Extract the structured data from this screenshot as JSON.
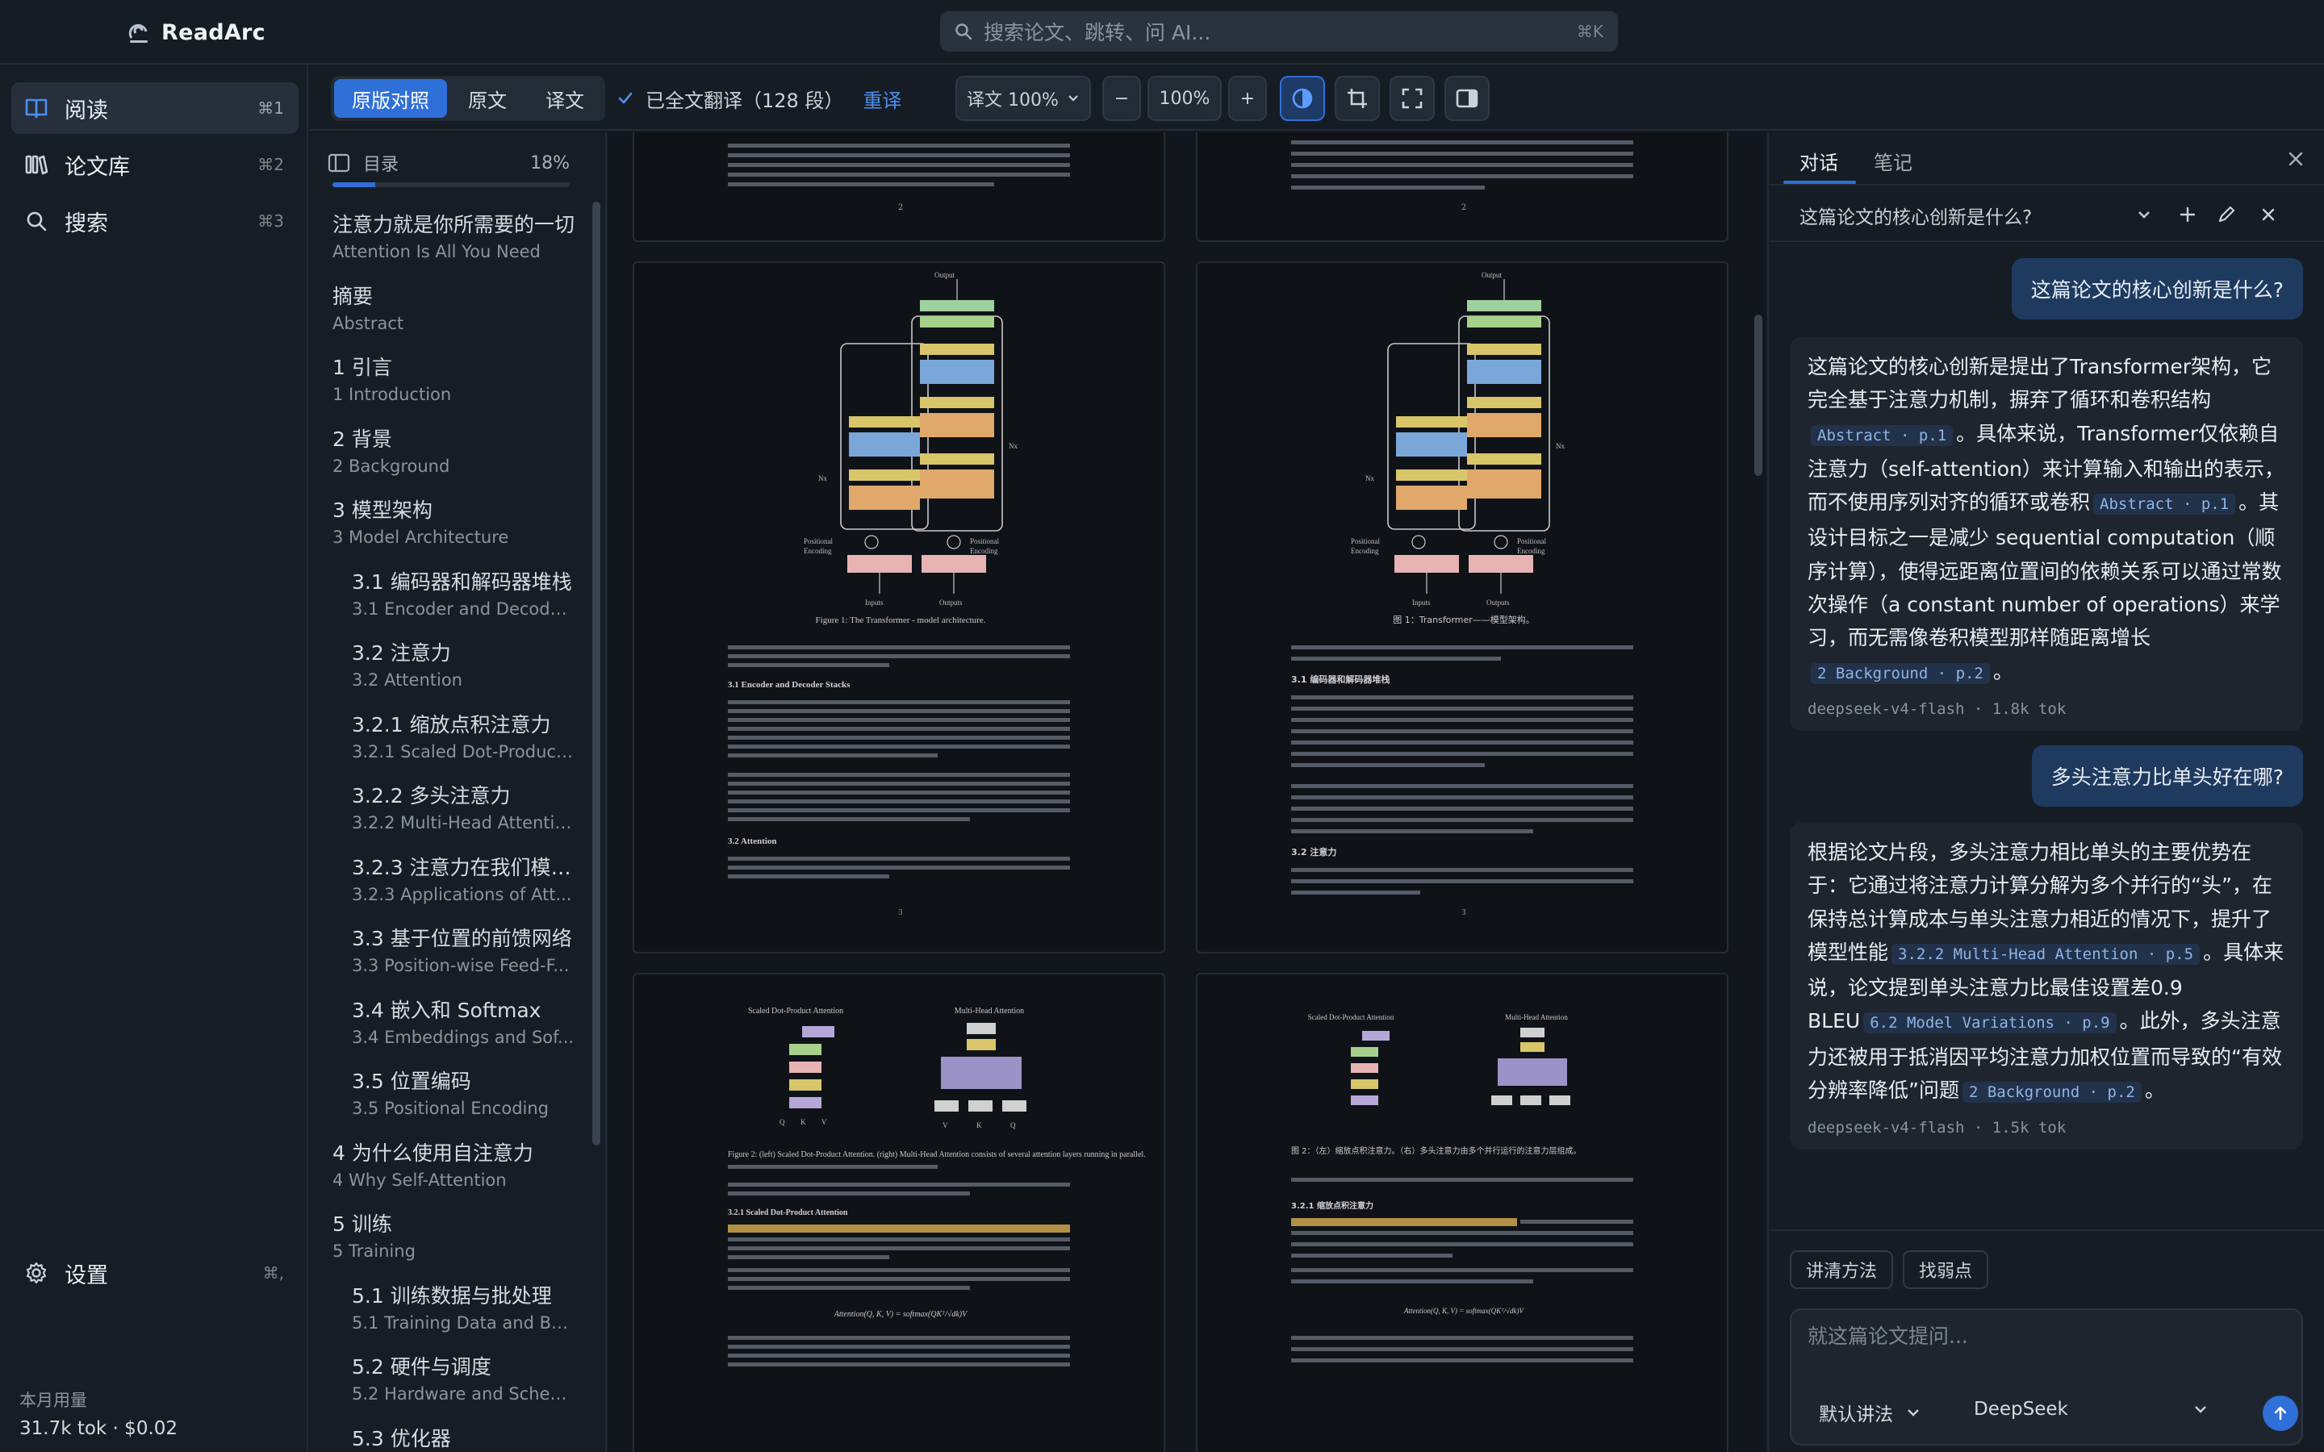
{
  "app": {
    "name": "ReadArc"
  },
  "search": {
    "placeholder": "搜索论文、跳转、问 AI...",
    "shortcut": "⌘K"
  },
  "nav": {
    "items": [
      {
        "label": "阅读",
        "shortcut": "⌘1"
      },
      {
        "label": "论文库",
        "shortcut": "⌘2"
      },
      {
        "label": "搜索",
        "shortcut": "⌘3"
      }
    ],
    "settings": {
      "label": "设置",
      "shortcut": "⌘,"
    },
    "usage": {
      "title": "本月用量",
      "value": "31.7k tok · $0.02"
    }
  },
  "toolbar": {
    "view_modes": [
      "原版对照",
      "原文",
      "译文"
    ],
    "active_mode": "原版对照",
    "status": "已全文翻译（128 段）",
    "retranslate": "重译",
    "translation_zoom": "译文 100%",
    "zoom_minus": "−",
    "zoom_value": "100%",
    "zoom_plus": "+"
  },
  "toc": {
    "title": "目录",
    "progress_label": "18%",
    "progress": 0.18,
    "items": [
      {
        "zh": "注意力就是你所需要的一切",
        "en": "Attention Is All You Need",
        "level": 0
      },
      {
        "zh": "摘要",
        "en": "Abstract",
        "level": 0
      },
      {
        "zh": "1 引言",
        "en": "1 Introduction",
        "level": 0
      },
      {
        "zh": "2 背景",
        "en": "2 Background",
        "level": 0
      },
      {
        "zh": "3 模型架构",
        "en": "3 Model Architecture",
        "level": 0
      },
      {
        "zh": "3.1 编码器和解码器堆栈",
        "en": "3.1 Encoder and Decoder...",
        "level": 1
      },
      {
        "zh": "3.2 注意力",
        "en": "3.2 Attention",
        "level": 1
      },
      {
        "zh": "3.2.1 缩放点积注意力",
        "en": "3.2.1 Scaled Dot-Product...",
        "level": 1
      },
      {
        "zh": "3.2.2 多头注意力",
        "en": "3.2.2 Multi-Head Attention",
        "level": 1
      },
      {
        "zh": "3.2.3 注意力在我们模型...",
        "en": "3.2.3 Applications of Att...",
        "level": 1
      },
      {
        "zh": "3.3 基于位置的前馈网络",
        "en": "3.3 Position-wise Feed-F...",
        "level": 1
      },
      {
        "zh": "3.4 嵌入和 Softmax",
        "en": "3.4 Embeddings and Sof...",
        "level": 1
      },
      {
        "zh": "3.5 位置编码",
        "en": "3.5 Positional Encoding",
        "level": 1
      },
      {
        "zh": "4 为什么使用自注意力",
        "en": "4 Why Self-Attention",
        "level": 0
      },
      {
        "zh": "5 训练",
        "en": "5 Training",
        "level": 0
      },
      {
        "zh": "5.1 训练数据与批处理",
        "en": "5.1 Training Data and Bat...",
        "level": 1
      },
      {
        "zh": "5.2 硬件与调度",
        "en": "5.2 Hardware and Sched...",
        "level": 1
      },
      {
        "zh": "5.3 优化器",
        "en": "",
        "level": 1
      }
    ]
  },
  "document": {
    "pages": {
      "p2_en_number": "2",
      "p2_zh_number": "2",
      "p3_en_number": "3",
      "p3_zh_number": "3",
      "fig1_caption_en": "Figure 1: The Transformer - model architecture.",
      "fig1_caption_zh": "图 1：Transformer——模型架构。",
      "sec31_en": "3.1    Encoder and Decoder Stacks",
      "sec31_zh": "3.1 编码器和解码器堆栈",
      "sec32_en": "3.2    Attention",
      "sec32_zh": "3.2 注意力",
      "fig2_left_title": "Scaled Dot-Product Attention",
      "fig2_right_title": "Multi-Head Attention",
      "fig2_caption_en": "Figure 2: (left) Scaled Dot-Product Attention. (right) Multi-Head Attention consists of several attention layers running in parallel.",
      "fig2_caption_zh": "图 2：（左）缩放点积注意力。（右）多头注意力由多个并行运行的注意力层组成。",
      "sec321_en": "3.2.1    Scaled Dot-Product Attention",
      "sec321_zh": "3.2.1 缩放点积注意力",
      "formula": "Attention(Q, K, V) = softmax(QKᵀ/√dk)V"
    }
  },
  "chat": {
    "tabs": [
      "对话",
      "笔记"
    ],
    "active_tab": "对话",
    "conversation_title": "这篇论文的核心创新是什么?",
    "messages": [
      {
        "role": "user",
        "text": "这篇论文的核心创新是什么?"
      },
      {
        "role": "assistant",
        "parts": [
          {
            "t": "这篇论文的核心创新是提出了Transformer架构，它完全基于注意力机制，摒弃了循环和卷积结构"
          },
          {
            "c": "Abstract · p.1"
          },
          {
            "t": "。具体来说，Transformer仅依赖自注意力（self-attention）来计算输入和输出的表示，而不使用序列对齐的循环或卷积"
          },
          {
            "c": "Abstract · p.1"
          },
          {
            "t": "。其设计目标之一是减少 sequential computation（顺序计算），使得远距离位置间的依赖关系可以通过常数次操作（a constant number of operations）来学习，而无需像卷积模型那样随距离增长"
          },
          {
            "c": "2 Background · p.2"
          },
          {
            "t": "。"
          }
        ],
        "meta": "deepseek-v4-flash · 1.8k tok"
      },
      {
        "role": "user",
        "text": "多头注意力比单头好在哪?"
      },
      {
        "role": "assistant",
        "parts": [
          {
            "t": "根据论文片段，多头注意力相比单头的主要优势在于：它通过将注意力计算分解为多个并行的“头”，在保持总计算成本与单头注意力相近的情况下，提升了模型性能"
          },
          {
            "c": "3.2.2 Multi-Head Attention · p.5"
          },
          {
            "t": "。具体来说，论文提到单头注意力比最佳设置差0.9 BLEU"
          },
          {
            "c": "6.2 Model Variations · p.9"
          },
          {
            "t": "。此外，多头注意力还被用于抵消因平均注意力加权位置而导致的“有效分辨率降低”问题"
          },
          {
            "c": "2 Background · p.2"
          },
          {
            "t": "。"
          }
        ],
        "meta": "deepseek-v4-flash · 1.5k tok"
      }
    ],
    "quick_actions": [
      "讲清方法",
      "找弱点"
    ],
    "composer": {
      "placeholder": "就这篇论文提问...",
      "style": "默认讲法",
      "model": "DeepSeek"
    }
  },
  "colors": {
    "accent": "#2f6fd8",
    "background": "#151b23",
    "panel": "#1e252e"
  }
}
